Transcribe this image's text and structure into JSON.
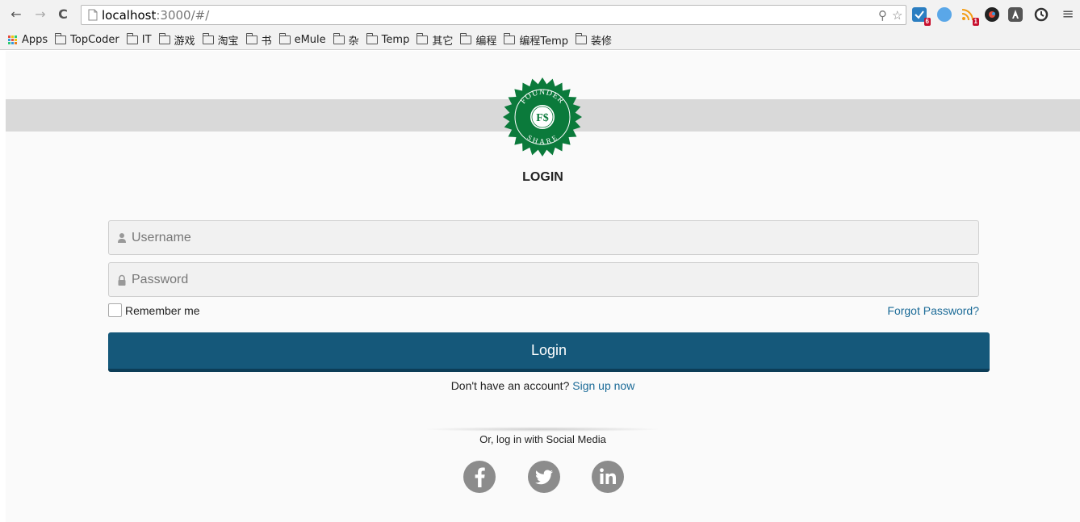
{
  "browser": {
    "url_host": "localhost",
    "url_rest": ":3000/#/",
    "bookmarks": [
      {
        "label": "Apps",
        "icon": "apps-grid-icon"
      },
      {
        "label": "TopCoder",
        "icon": "folder-icon"
      },
      {
        "label": "IT",
        "icon": "folder-icon"
      },
      {
        "label": "游戏",
        "icon": "folder-icon"
      },
      {
        "label": "淘宝",
        "icon": "folder-icon"
      },
      {
        "label": "书",
        "icon": "folder-icon"
      },
      {
        "label": "eMule",
        "icon": "folder-icon"
      },
      {
        "label": "杂",
        "icon": "folder-icon"
      },
      {
        "label": "Temp",
        "icon": "folder-icon"
      },
      {
        "label": "其它",
        "icon": "folder-icon"
      },
      {
        "label": "编程",
        "icon": "folder-icon"
      },
      {
        "label": "编程Temp",
        "icon": "folder-icon"
      },
      {
        "label": "装修",
        "icon": "folder-icon"
      }
    ],
    "extensions": [
      {
        "icon": "checklist-extension-icon",
        "badge": "6",
        "color": "#2b7ec1"
      },
      {
        "icon": "compass-extension-icon",
        "badge": "",
        "color": "#5aa7e8"
      },
      {
        "icon": "rss-extension-icon",
        "badge": "1",
        "color": "#f39c12"
      },
      {
        "icon": "color-picker-extension-icon",
        "badge": "",
        "color": "#222222"
      },
      {
        "icon": "angular-extension-icon",
        "badge": "",
        "color": "#555555"
      },
      {
        "icon": "clock-extension-icon",
        "badge": "",
        "color": "#333333"
      }
    ]
  },
  "page": {
    "logo_text_top": "FOUNDER",
    "logo_text_bottom": "SHARE",
    "logo_monogram": "F$",
    "title": "LOGIN",
    "username_placeholder": "Username",
    "password_placeholder": "Password",
    "remember_label": "Remember me",
    "forgot_label": "Forgot Password?",
    "login_label": "Login",
    "signup_prompt": "Don't have an account?",
    "signup_link": "Sign up now",
    "social_text": "Or, log in with Social Media",
    "social": [
      "facebook-icon",
      "twitter-icon",
      "linkedin-icon"
    ]
  },
  "colors": {
    "primary_button": "#15587a",
    "link": "#1a6a97",
    "logo_green": "#0b7a3b",
    "social_icon": "#8c8c8c"
  }
}
